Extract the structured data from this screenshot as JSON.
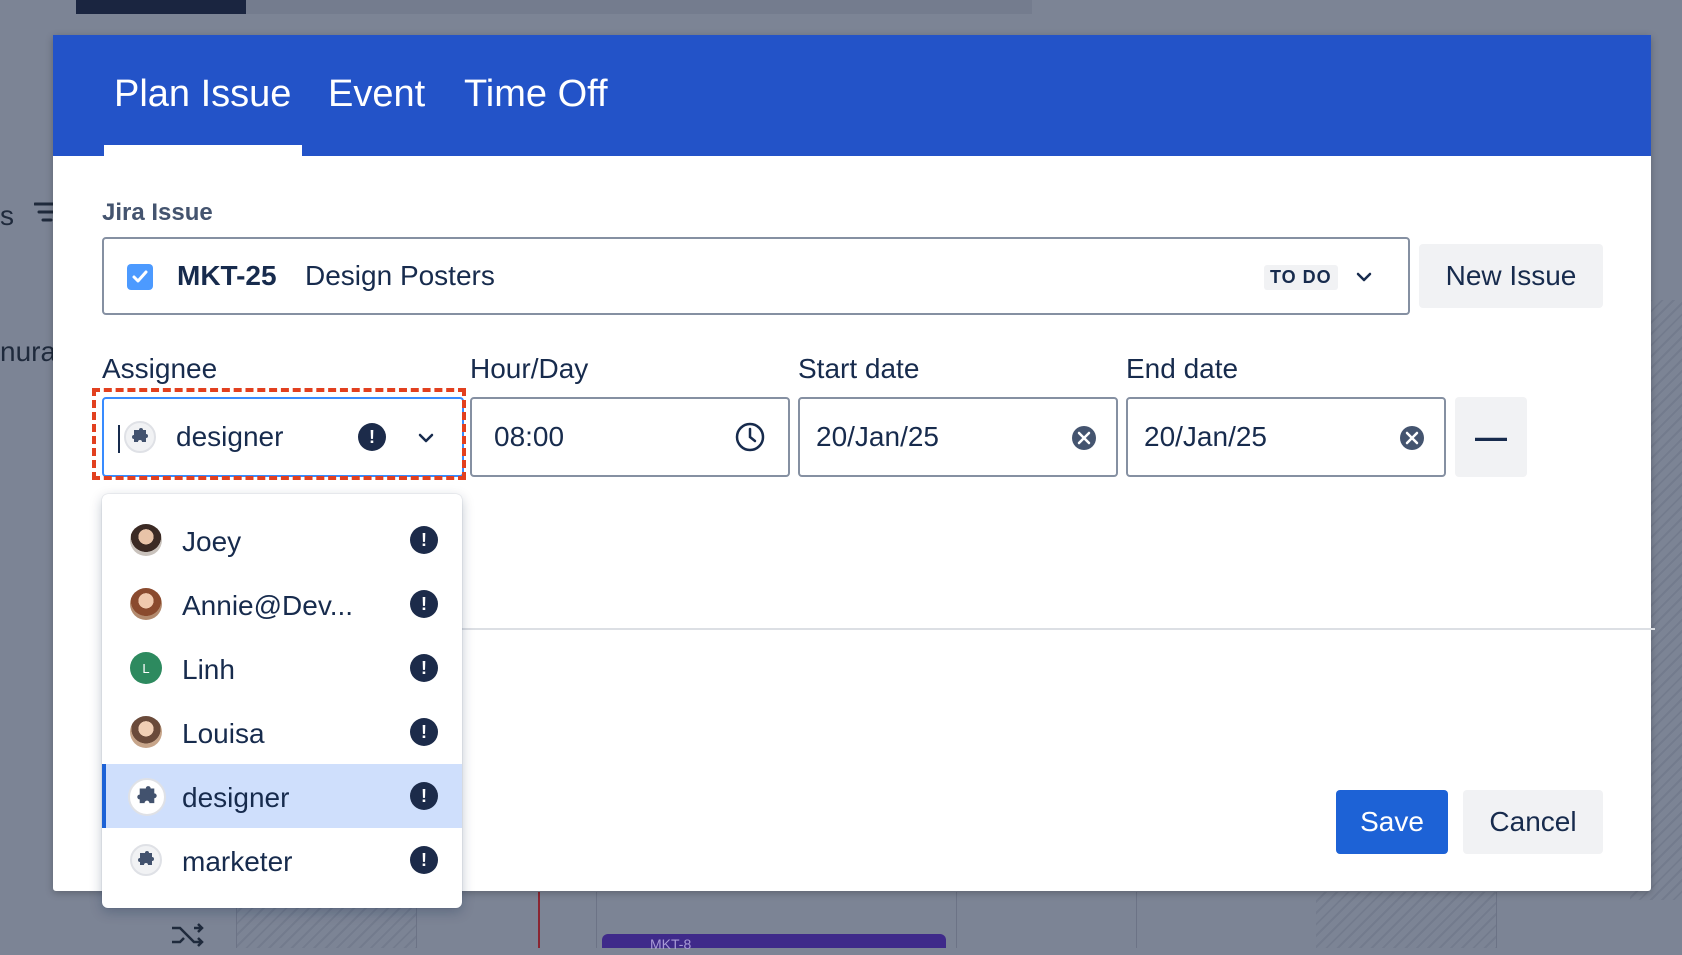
{
  "background": {
    "left_text": "nura",
    "left_letter": "s",
    "card_text": "MKT-8"
  },
  "modal": {
    "tabs": [
      {
        "label": "Plan Issue",
        "active": true
      },
      {
        "label": "Event",
        "active": false
      },
      {
        "label": "Time Off",
        "active": false
      }
    ],
    "jira_issue": {
      "label": "Jira Issue",
      "key": "MKT-25",
      "summary": "Design Posters",
      "status": "TO DO",
      "new_issue_button": "New Issue"
    },
    "assignee": {
      "label": "Assignee",
      "value": "designer"
    },
    "hour_day": {
      "label": "Hour/Day",
      "value": "08:00"
    },
    "start_date": {
      "label": "Start date",
      "value": "20/Jan/25"
    },
    "end_date": {
      "label": "End date",
      "value": "20/Jan/25"
    },
    "remove_button": "—",
    "save_button": "Save",
    "cancel_button": "Cancel"
  },
  "assignee_menu": {
    "items": [
      {
        "label": "Joey",
        "avatar": "photo-avatar",
        "selected": false
      },
      {
        "label": "Annie@Dev...",
        "avatar": "photo-avatar",
        "selected": false
      },
      {
        "label": "Linh",
        "avatar": "initial-avatar",
        "initial": "L",
        "selected": false
      },
      {
        "label": "Louisa",
        "avatar": "photo-avatar",
        "selected": false
      },
      {
        "label": "designer",
        "avatar": "puzzle-icon",
        "selected": true
      },
      {
        "label": "marketer",
        "avatar": "puzzle-icon",
        "selected": false
      }
    ],
    "warning_icon": "!"
  },
  "colors": {
    "header": "#2353c8",
    "primary_button": "#1d62d6",
    "selected_item": "#cfdffc",
    "focus_outline": "#e2401f",
    "linh_avatar": "#2d8a5f"
  }
}
